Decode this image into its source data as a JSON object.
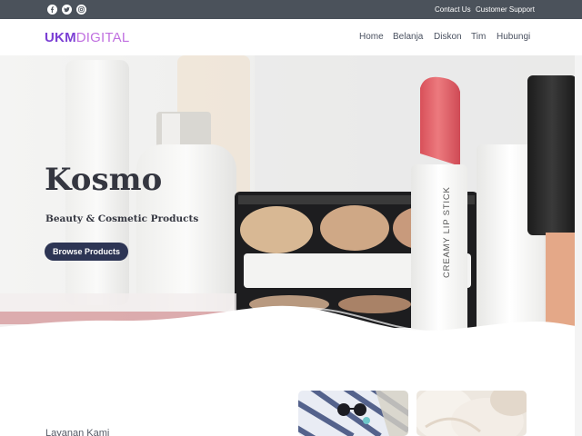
{
  "topbar": {
    "social": [
      {
        "icon": "facebook-icon"
      },
      {
        "icon": "twitter-icon"
      },
      {
        "icon": "instagram-icon"
      }
    ],
    "links": [
      "Contact Us",
      "Customer Support"
    ]
  },
  "header": {
    "logo_part1": "UKM",
    "logo_part2": "DIGITAL",
    "nav": [
      "Home",
      "Belanja",
      "Diskon",
      "Tim",
      "Hubungi"
    ]
  },
  "hero": {
    "title": "Kosmo",
    "subtitle": "Beauty & Cosmetic Products",
    "button_label": "Browse Products",
    "lipstick_text": "CREAMY LIP STICK"
  },
  "section": {
    "heading": "Layanan Kami"
  },
  "colors": {
    "topbar": "#4b525b",
    "button": "#2d3554",
    "logo_primary": "#7b3fd4",
    "logo_secondary": "#c070e0",
    "lipstick": "#e0636a"
  }
}
